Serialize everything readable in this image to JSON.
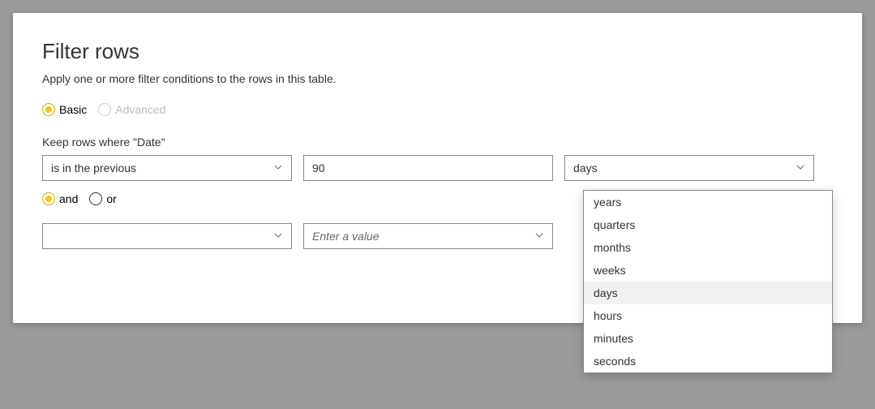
{
  "dialog": {
    "title": "Filter rows",
    "subtitle": "Apply one or more filter conditions to the rows in this table."
  },
  "mode": {
    "basic": "Basic",
    "advanced": "Advanced",
    "selected": "basic"
  },
  "keep_label": "Keep rows where \"Date\"",
  "row1": {
    "operator": "is in the previous",
    "value": "90",
    "unit": "days"
  },
  "connector": {
    "and": "and",
    "or": "or",
    "selected": "and"
  },
  "row2": {
    "operator": "",
    "value_placeholder": "Enter a value"
  },
  "unit_options": [
    "years",
    "quarters",
    "months",
    "weeks",
    "days",
    "hours",
    "minutes",
    "seconds"
  ],
  "unit_selected_index": 4
}
